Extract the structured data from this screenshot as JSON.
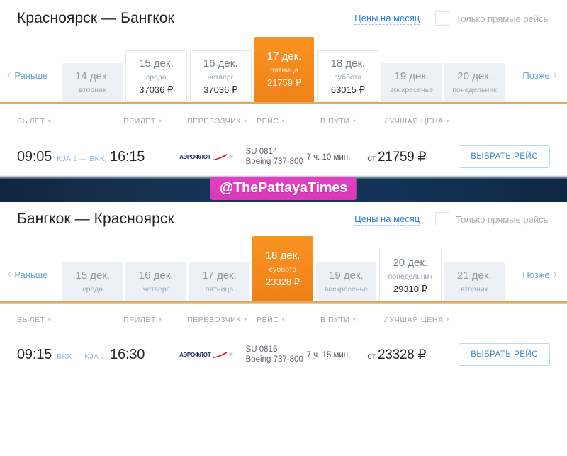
{
  "sections": [
    {
      "id": "outbound",
      "route_title": "Красноярск — Бангкок",
      "month_prices_label": "Цены на месяц",
      "direct_only_label": "Только прямые рейсы",
      "direct_only_checked": false,
      "nav": {
        "earlier": "Раньше",
        "later": "Позже"
      },
      "dates": [
        {
          "day": "14 дек.",
          "dow": "вторник",
          "price": "",
          "state": "plain"
        },
        {
          "day": "15 дек.",
          "dow": "среда",
          "price": "37036 ₽",
          "state": "priced"
        },
        {
          "day": "16 дек.",
          "dow": "четверг",
          "price": "37036 ₽",
          "state": "priced"
        },
        {
          "day": "17 дек.",
          "dow": "пятница",
          "price": "21759 ₽",
          "state": "selected"
        },
        {
          "day": "18 дек.",
          "dow": "суббота",
          "price": "63015 ₽",
          "state": "priced"
        },
        {
          "day": "19 дек.",
          "dow": "воскресенье",
          "price": "",
          "state": "plain"
        },
        {
          "day": "20 дек.",
          "dow": "понедельник",
          "price": "",
          "state": "plain"
        }
      ],
      "columns": {
        "depart": "ВЫЛЕТ",
        "arrive": "ПРИЛЕТ",
        "carrier": "ПЕРЕВОЗЧИК",
        "flight": "РЕЙС",
        "duration": "В ПУТИ",
        "price": "ЛУЧШАЯ ЦЕНА"
      },
      "flight": {
        "depart_time": "09:05",
        "origin_iata": "KJA",
        "origin_terminal": "1",
        "dash": "—",
        "destination_iata": "BKK",
        "arrive_time": "16:15",
        "carrier_name": "АЭРОФЛОТ",
        "flight_number": "SU 0814",
        "aircraft": "Boeing 737-800",
        "duration": "7 ч. 10 мин.",
        "price_prefix": "от",
        "price": "21759 ₽",
        "select_label": "Выбрать рейс"
      }
    },
    {
      "id": "inbound",
      "route_title": "Бангкок — Красноярск",
      "month_prices_label": "Цены на месяц",
      "direct_only_label": "Только прямые рейсы",
      "direct_only_checked": false,
      "nav": {
        "earlier": "Раньше",
        "later": "Позже"
      },
      "dates": [
        {
          "day": "15 дек.",
          "dow": "среда",
          "price": "",
          "state": "plain"
        },
        {
          "day": "16 дек.",
          "dow": "четверг",
          "price": "",
          "state": "plain"
        },
        {
          "day": "17 дек.",
          "dow": "пятница",
          "price": "",
          "state": "plain"
        },
        {
          "day": "18 дек.",
          "dow": "суббота",
          "price": "23328 ₽",
          "state": "selected"
        },
        {
          "day": "19 дек.",
          "dow": "воскресенье",
          "price": "",
          "state": "plain"
        },
        {
          "day": "20 дек.",
          "dow": "понедельник",
          "price": "29310 ₽",
          "state": "priced"
        },
        {
          "day": "21 дек.",
          "dow": "вторник",
          "price": "",
          "state": "plain"
        }
      ],
      "columns": {
        "depart": "ВЫЛЕТ",
        "arrive": "ПРИЛЕТ",
        "carrier": "ПЕРЕВОЗЧИК",
        "flight": "РЕЙС",
        "duration": "В ПУТИ",
        "price": "ЛУЧШАЯ ЦЕНА"
      },
      "flight": {
        "depart_time": "09:15",
        "origin_iata": "BKK",
        "origin_terminal": "",
        "dash": "—",
        "destination_iata": "KJA",
        "destination_terminal": "1",
        "arrive_time": "16:30",
        "carrier_name": "АЭРОФЛОТ",
        "flight_number": "SU 0815",
        "aircraft": "Boeing 737-800",
        "duration": "7 ч. 15 мин.",
        "price_prefix": "от",
        "price": "23328 ₽",
        "select_label": "Выбрать рейс"
      }
    }
  ],
  "banner": {
    "watermark_text": "@ThePattayaTimes",
    "watermark_bg": "#e03ec0",
    "banner_bg": "#16314f"
  },
  "colors": {
    "accent_orange": "#f0811a",
    "link_blue": "#2f80d8",
    "tile_bg": "#edf1f6",
    "rule_orange": "#d9a14e"
  },
  "icons": {
    "chevron_left": "‹",
    "chevron_right": "›",
    "caret_down": "▾"
  }
}
